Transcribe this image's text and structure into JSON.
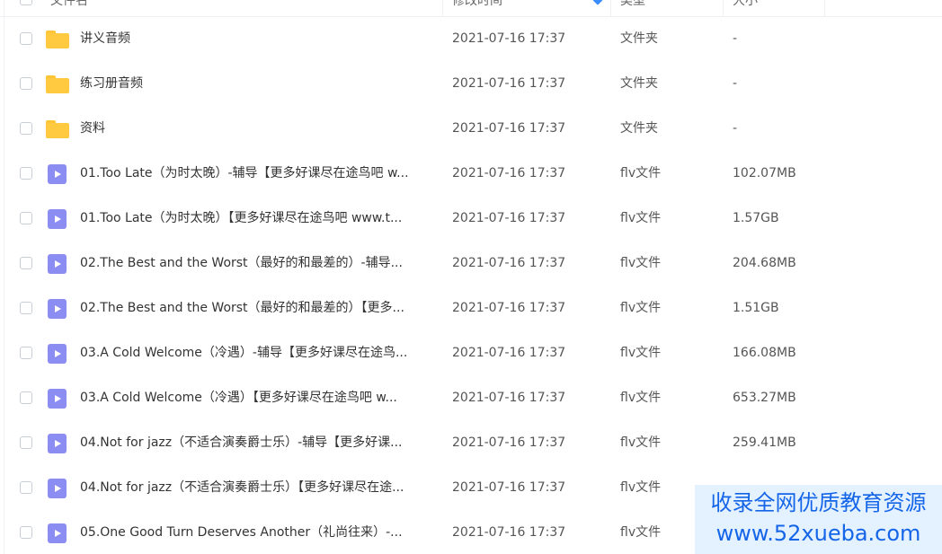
{
  "header": {
    "name": "文件名",
    "modified": "修改时间",
    "type": "类型",
    "size": "大小"
  },
  "rows": [
    {
      "icon": "folder-icon",
      "name": "讲义音频",
      "date": "2021-07-16 17:37",
      "type": "文件夹",
      "size": "-"
    },
    {
      "icon": "folder-icon",
      "name": "练习册音频",
      "date": "2021-07-16 17:37",
      "type": "文件夹",
      "size": "-"
    },
    {
      "icon": "folder-icon",
      "name": "资料",
      "date": "2021-07-16 17:37",
      "type": "文件夹",
      "size": "-"
    },
    {
      "icon": "video-file-icon",
      "name": "01.Too Late（为时太晚）-辅导【更多好课尽在途鸟吧 w...",
      "date": "2021-07-16 17:37",
      "type": "flv文件",
      "size": "102.07MB"
    },
    {
      "icon": "video-file-icon",
      "name": "01.Too Late（为时太晚）【更多好课尽在途鸟吧 www.t...",
      "date": "2021-07-16 17:37",
      "type": "flv文件",
      "size": "1.57GB"
    },
    {
      "icon": "video-file-icon",
      "name": "02.The Best and the Worst（最好的和最差的）-辅导...",
      "date": "2021-07-16 17:37",
      "type": "flv文件",
      "size": "204.68MB"
    },
    {
      "icon": "video-file-icon",
      "name": "02.The Best and the Worst（最好的和最差的）【更多...",
      "date": "2021-07-16 17:37",
      "type": "flv文件",
      "size": "1.51GB"
    },
    {
      "icon": "video-file-icon",
      "name": "03.A Cold Welcome（冷遇）-辅导【更多好课尽在途鸟...",
      "date": "2021-07-16 17:37",
      "type": "flv文件",
      "size": "166.08MB"
    },
    {
      "icon": "video-file-icon",
      "name": "03.A Cold Welcome（冷遇）【更多好课尽在途鸟吧 w...",
      "date": "2021-07-16 17:37",
      "type": "flv文件",
      "size": "653.27MB"
    },
    {
      "icon": "video-file-icon",
      "name": "04.Not for jazz（不适合演奏爵士乐）-辅导【更多好课...",
      "date": "2021-07-16 17:37",
      "type": "flv文件",
      "size": "259.41MB"
    },
    {
      "icon": "video-file-icon",
      "name": "04.Not for jazz（不适合演奏爵士乐）【更多好课尽在途...",
      "date": "2021-07-16 17:37",
      "type": "flv文件",
      "size": ""
    },
    {
      "icon": "video-file-icon",
      "name": "05.One Good Turn Deserves Another（礼尚往来）-...",
      "date": "2021-07-16 17:37",
      "type": "flv文件",
      "size": ""
    }
  ],
  "watermark": {
    "line1": "收录全网优质教育资源",
    "line2": "www.52xueba.com"
  },
  "colors": {
    "folder": "#ffc940",
    "video_icon": "#8c8df3",
    "sort_indicator": "#3b8cff",
    "watermark_text": "#1565e8"
  }
}
